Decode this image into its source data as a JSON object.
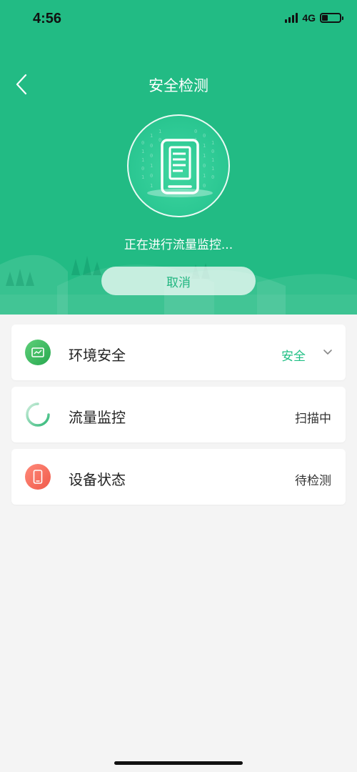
{
  "status_bar": {
    "time": "4:56",
    "network": "4G",
    "battery_level": 0.35,
    "icons": [
      "signal-bars-icon",
      "battery-icon"
    ]
  },
  "header": {
    "title": "安全检测",
    "back_icon": "back-chevron-icon",
    "phone_icon": "smartphone-document-icon",
    "scan_text": "正在进行流量监控...",
    "cancel_label": "取消"
  },
  "checks": [
    {
      "label": "环境安全",
      "status": "安全",
      "icon": "monitor-chart-icon",
      "expand_icon": "chevron-down-icon"
    },
    {
      "label": "流量监控",
      "status": "扫描中",
      "icon": "loading-spinner-icon"
    },
    {
      "label": "设备状态",
      "status": "待检测",
      "icon": "phone-icon"
    }
  ],
  "colors": {
    "primary": "#22bb84",
    "safe_text": "#1fbf84",
    "env_icon": "#3dbb63",
    "device_icon": "#f26b5b",
    "background": "#f4f4f4"
  }
}
